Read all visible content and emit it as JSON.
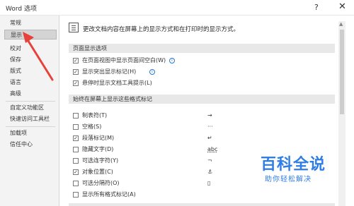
{
  "window": {
    "title": "Word 选项",
    "help_glyph": "?",
    "close_glyph": "✕"
  },
  "sidebar": {
    "items": [
      {
        "label": "常规"
      },
      {
        "label": "显示"
      },
      {
        "label": "校对"
      },
      {
        "label": "保存"
      },
      {
        "label": "版式"
      },
      {
        "label": "语言"
      },
      {
        "label": "高级"
      },
      {
        "label": "自定义功能区"
      },
      {
        "label": "快速访问工具栏"
      },
      {
        "label": "加载项"
      },
      {
        "label": "信任中心"
      }
    ],
    "active_index": 1
  },
  "main": {
    "intro": "更改文档内容在屏幕上的显示方式和在打印时的显示方式。",
    "page_display": {
      "header": "页面显示选项",
      "options": [
        {
          "label": "在页面视图中显示页面间空白(W)",
          "checked": true,
          "info": true
        },
        {
          "label": "显示突出显示标记(H)",
          "checked": true,
          "info": true
        },
        {
          "label": "悬停时显示文档工具提示(L)",
          "checked": true,
          "info": false
        }
      ]
    },
    "formatting_marks": {
      "header": "始终在屏幕上显示这些格式标记",
      "options": [
        {
          "label": "制表符(T)",
          "checked": false,
          "mark": "→"
        },
        {
          "label": "空格(S)",
          "checked": false,
          "mark": "···"
        },
        {
          "label": "段落标记(M)",
          "checked": true,
          "mark": "↵"
        },
        {
          "label": "隐藏文字(D)",
          "checked": false,
          "mark": "abc"
        },
        {
          "label": "可选连字符(Y)",
          "checked": false,
          "mark": "¬"
        },
        {
          "label": "对象位置(C)",
          "checked": true,
          "mark": "⚓"
        },
        {
          "label": "可选分隔符(O)",
          "checked": false,
          "mark": "▯"
        },
        {
          "label": "显示所有格式标记(A)",
          "checked": false,
          "mark": ""
        }
      ]
    }
  },
  "watermark": {
    "big": "百科全说",
    "small": "助你轻松解决"
  },
  "colors": {
    "arrow": "#e8413a",
    "watermark": "#2f7ee6",
    "info_icon": "#2b78c5"
  }
}
